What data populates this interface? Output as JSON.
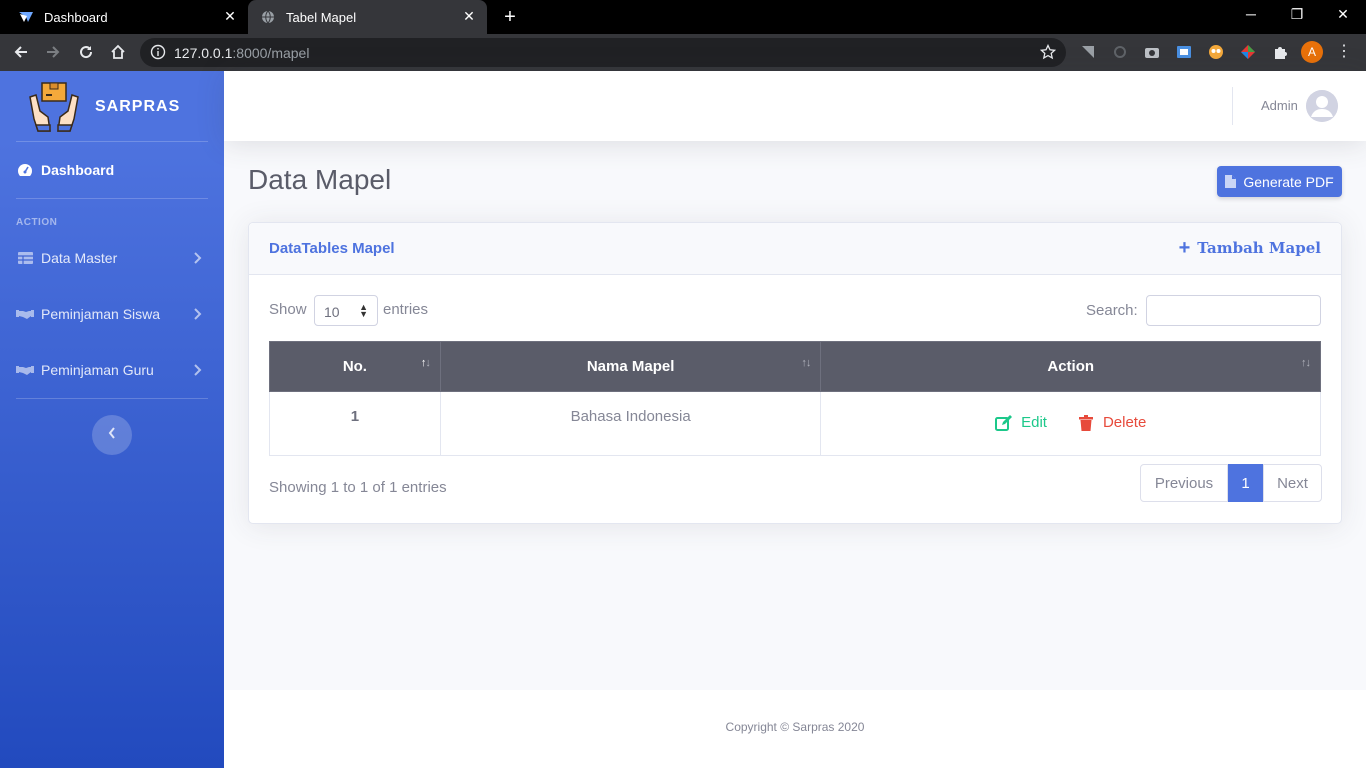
{
  "browser": {
    "tabs": [
      {
        "title": "Dashboard",
        "active": false
      },
      {
        "title": "Tabel Mapel",
        "active": true
      }
    ],
    "url_host": "127.0.0.1",
    "url_rest": ":8000/mapel",
    "profile_initial": "A"
  },
  "sidebar": {
    "brand": "SARPRAS",
    "dashboard_label": "Dashboard",
    "heading": "ACTION",
    "items": [
      {
        "label": "Data Master",
        "icon": "table-icon"
      },
      {
        "label": "Peminjaman Siswa",
        "icon": "handshake-icon"
      },
      {
        "label": "Peminjaman Guru",
        "icon": "handshake-icon"
      }
    ]
  },
  "topbar": {
    "user_name": "Admin"
  },
  "page": {
    "title": "Data Mapel",
    "generate_pdf": "Generate PDF"
  },
  "card": {
    "title": "DataTables Mapel",
    "add_label": "Tambah Mapel",
    "show_label": "Show",
    "entries_label": "entries",
    "page_length": "10",
    "search_label": "Search:",
    "search_value": "",
    "columns": [
      "No.",
      "Nama Mapel",
      "Action"
    ],
    "rows": [
      {
        "no": "1",
        "nama": "Bahasa Indonesia"
      }
    ],
    "edit_label": "Edit",
    "delete_label": "Delete",
    "info": "Showing 1 to 1 of 1 entries",
    "pagination": {
      "previous": "Previous",
      "current": "1",
      "next": "Next"
    }
  },
  "footer": {
    "copyright": "Copyright © Sarpras 2020"
  },
  "colors": {
    "primary": "#4e73df",
    "success": "#1cc88a",
    "danger": "#e74a3b",
    "header_dark": "#5a5c69"
  }
}
